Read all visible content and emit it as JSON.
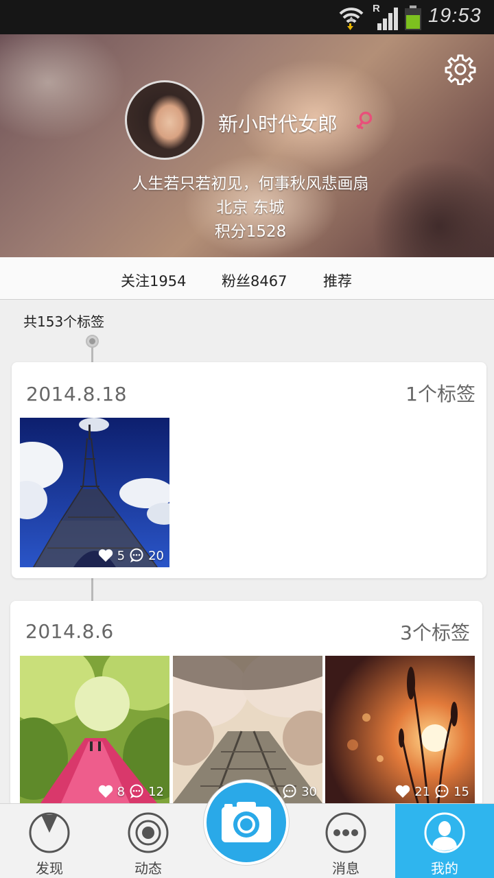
{
  "status_bar": {
    "time": "19:53",
    "network_label": "R"
  },
  "profile": {
    "username": "新小时代女郎",
    "bio": "人生若只若初见，何事秋风悲画扇",
    "location": "北京 东城",
    "points": "积分1528"
  },
  "stats": {
    "following": "关注1954",
    "followers": "粉丝8467",
    "recommend": "推荐"
  },
  "timeline": {
    "total_tags": "共153个标签",
    "groups": [
      {
        "date": "2014.8.18",
        "tag_count": "1个标签",
        "photos": [
          {
            "subject": "eiffel-tower",
            "likes": "5",
            "comments": "20"
          }
        ]
      },
      {
        "date": "2014.8.6",
        "tag_count": "3个标签",
        "photos": [
          {
            "subject": "forest-path",
            "likes": "8",
            "comments": "12"
          },
          {
            "subject": "cherry-blossom-railway",
            "likes": "",
            "comments": "30"
          },
          {
            "subject": "sunset-grass",
            "likes": "21",
            "comments": "15"
          }
        ]
      }
    ]
  },
  "nav": {
    "items": [
      {
        "label": "发现",
        "icon": "compass-icon"
      },
      {
        "label": "动态",
        "icon": "target-icon"
      },
      {
        "label": "",
        "icon": "camera-icon"
      },
      {
        "label": "消息",
        "icon": "more-dots-icon"
      },
      {
        "label": "我的",
        "icon": "user-icon"
      }
    ],
    "active_index": 4
  },
  "colors": {
    "accent": "#2fb5ee",
    "gender_female": "#e8507a"
  }
}
